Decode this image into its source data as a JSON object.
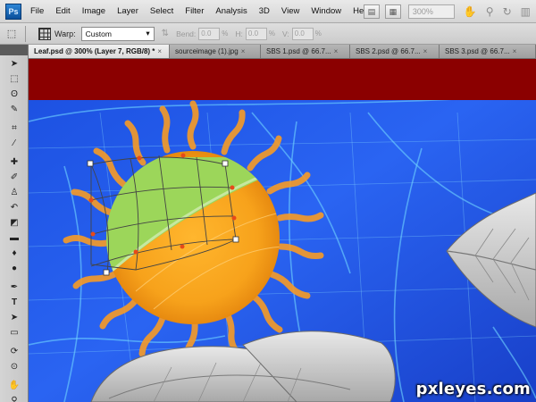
{
  "app": {
    "logo": "Ps"
  },
  "menu": {
    "items": [
      "File",
      "Edit",
      "Image",
      "Layer",
      "Select",
      "Filter",
      "Analysis",
      "3D",
      "View",
      "Window",
      "Help"
    ]
  },
  "menubar_tools": {
    "zoom": "300%"
  },
  "options": {
    "warp_label": "Warp:",
    "warp_value": "Custom",
    "bend_label": "Bend:",
    "bend_value": "0.0",
    "h_label": "H:",
    "h_value": "0.0",
    "v_label": "V:",
    "v_value": "0.0",
    "pct": "%"
  },
  "tabs": [
    {
      "label": "Leaf.psd @ 300% (Layer 7, RGB/8) *",
      "close": "×",
      "active": true
    },
    {
      "label": "sourceimage (1).jpg",
      "close": "×",
      "active": false
    },
    {
      "label": "SBS 1.psd @ 66.7...",
      "close": "×",
      "active": false
    },
    {
      "label": "SBS 2.psd @ 66.7...",
      "close": "×",
      "active": false
    },
    {
      "label": "SBS 3.psd @ 66.7...",
      "close": "×",
      "active": false
    }
  ],
  "tools": [
    "move-tool",
    "marquee-tool",
    "lasso-tool",
    "quick-select-tool",
    "crop-tool",
    "eyedropper-tool",
    "healing-brush-tool",
    "brush-tool",
    "clone-stamp-tool",
    "history-brush-tool",
    "eraser-tool",
    "gradient-tool",
    "blur-tool",
    "dodge-tool",
    "pen-tool",
    "type-tool",
    "path-select-tool",
    "shape-tool",
    "3d-rotate-tool",
    "3d-orbit-tool",
    "hand-tool",
    "zoom-tool"
  ],
  "colors": {
    "banner": "#8b0000",
    "background_blue": "#1e58e8",
    "sun_orange": "#f7a21b",
    "ray_orange": "#f39a2a",
    "leaf_green": "#9cd65a"
  },
  "watermark": "pxleyes.com"
}
